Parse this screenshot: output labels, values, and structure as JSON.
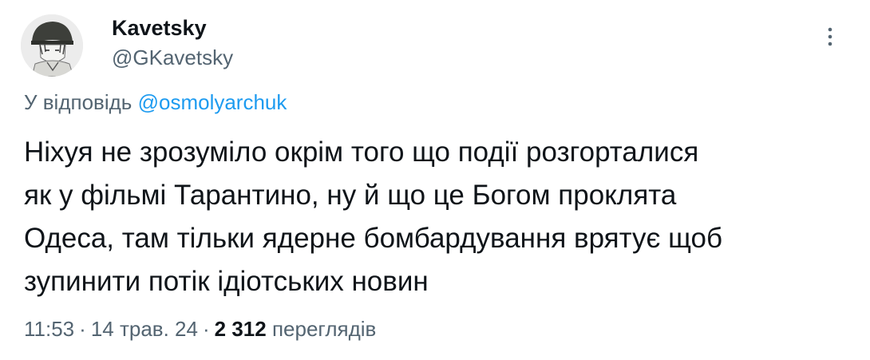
{
  "author": {
    "display_name": "Kavetsky",
    "handle": "@GKavetsky"
  },
  "reply": {
    "prefix": "У відповідь",
    "to_handle": "@osmolyarchuk"
  },
  "tweet": {
    "lines": [
      "Ніхуя не зрозуміло окрім того що події розгорталися",
      "як у фільмі Тарантино, ну й що це Богом проклята",
      "Одеса, там тільки ядерне бомбардування врятує щоб",
      "зупинити потік ідіотських новин"
    ]
  },
  "meta": {
    "time": "11:53",
    "separator": "·",
    "date": "14 трав. 24",
    "views_count": "2 312",
    "views_label": "переглядів"
  },
  "icons": {
    "more": "more-vertical-icon",
    "avatar": "avatar-image"
  },
  "colors": {
    "text_primary": "#0f1419",
    "text_secondary": "#536471",
    "link": "#1d9bf0"
  }
}
